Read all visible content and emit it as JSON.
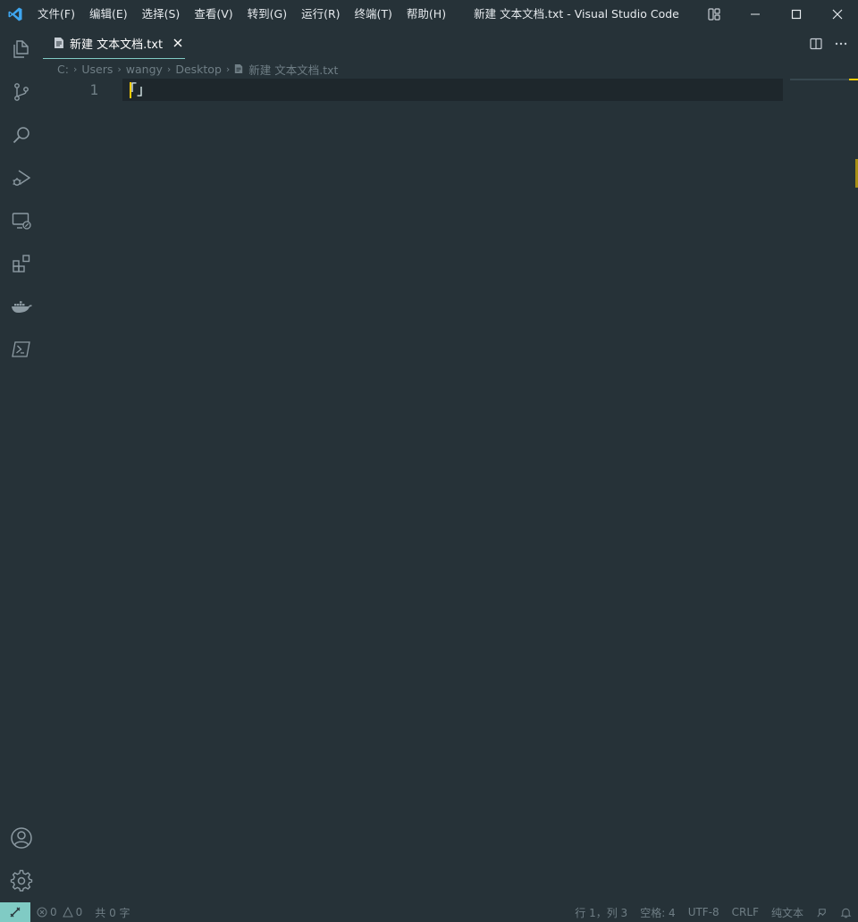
{
  "window": {
    "title": "新建 文本文档.txt - Visual Studio Code"
  },
  "menu": {
    "items": [
      "文件(F)",
      "编辑(E)",
      "选择(S)",
      "查看(V)",
      "转到(G)",
      "运行(R)",
      "终端(T)",
      "帮助(H)"
    ]
  },
  "activity_bar": {
    "top": [
      "explorer-icon",
      "source-control-icon",
      "search-icon",
      "run-debug-icon",
      "remote-explorer-icon",
      "extensions-icon",
      "docker-icon",
      "powershell-icon"
    ],
    "bottom": [
      "accounts-icon",
      "manage-gear-icon"
    ]
  },
  "tab": {
    "label": "新建 文本文档.txt"
  },
  "breadcrumb": {
    "items": [
      "C:",
      "Users",
      "wangy",
      "Desktop",
      "新建 文本文档.txt"
    ]
  },
  "editor": {
    "line_number": "1",
    "line_text": "「」"
  },
  "status": {
    "errors": "0",
    "warnings": "0",
    "word_count": "共 0 字",
    "position": "行 1，列 3",
    "indent": "空格: 4",
    "encoding": "UTF-8",
    "eol": "CRLF",
    "language": "纯文本"
  },
  "colors": {
    "background": "#263238",
    "accent": "#80cbc4",
    "cursor": "#ffcc00"
  }
}
